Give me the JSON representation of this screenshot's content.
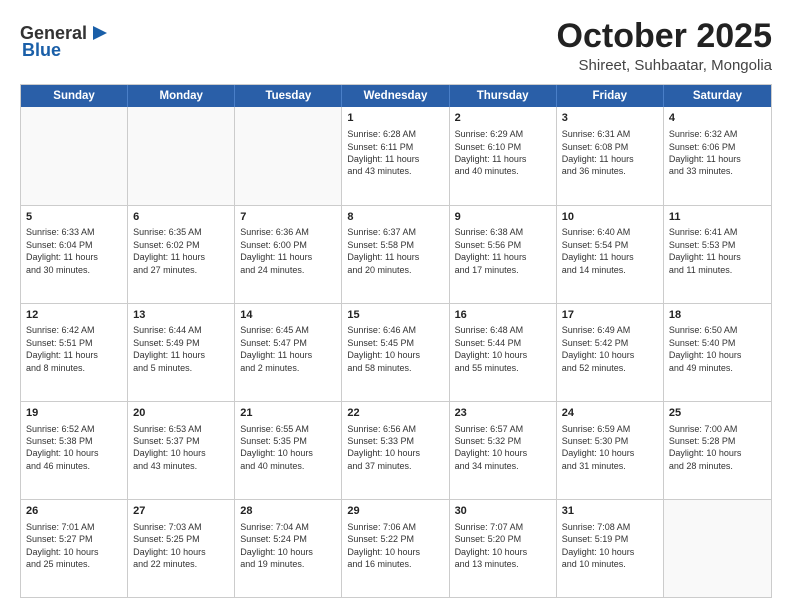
{
  "header": {
    "logo_general": "General",
    "logo_blue": "Blue",
    "month_title": "October 2025",
    "location": "Shireet, Suhbaatar, Mongolia"
  },
  "weekdays": [
    "Sunday",
    "Monday",
    "Tuesday",
    "Wednesday",
    "Thursday",
    "Friday",
    "Saturday"
  ],
  "rows": [
    [
      {
        "day": "",
        "text": ""
      },
      {
        "day": "",
        "text": ""
      },
      {
        "day": "",
        "text": ""
      },
      {
        "day": "1",
        "text": "Sunrise: 6:28 AM\nSunset: 6:11 PM\nDaylight: 11 hours\nand 43 minutes."
      },
      {
        "day": "2",
        "text": "Sunrise: 6:29 AM\nSunset: 6:10 PM\nDaylight: 11 hours\nand 40 minutes."
      },
      {
        "day": "3",
        "text": "Sunrise: 6:31 AM\nSunset: 6:08 PM\nDaylight: 11 hours\nand 36 minutes."
      },
      {
        "day": "4",
        "text": "Sunrise: 6:32 AM\nSunset: 6:06 PM\nDaylight: 11 hours\nand 33 minutes."
      }
    ],
    [
      {
        "day": "5",
        "text": "Sunrise: 6:33 AM\nSunset: 6:04 PM\nDaylight: 11 hours\nand 30 minutes."
      },
      {
        "day": "6",
        "text": "Sunrise: 6:35 AM\nSunset: 6:02 PM\nDaylight: 11 hours\nand 27 minutes."
      },
      {
        "day": "7",
        "text": "Sunrise: 6:36 AM\nSunset: 6:00 PM\nDaylight: 11 hours\nand 24 minutes."
      },
      {
        "day": "8",
        "text": "Sunrise: 6:37 AM\nSunset: 5:58 PM\nDaylight: 11 hours\nand 20 minutes."
      },
      {
        "day": "9",
        "text": "Sunrise: 6:38 AM\nSunset: 5:56 PM\nDaylight: 11 hours\nand 17 minutes."
      },
      {
        "day": "10",
        "text": "Sunrise: 6:40 AM\nSunset: 5:54 PM\nDaylight: 11 hours\nand 14 minutes."
      },
      {
        "day": "11",
        "text": "Sunrise: 6:41 AM\nSunset: 5:53 PM\nDaylight: 11 hours\nand 11 minutes."
      }
    ],
    [
      {
        "day": "12",
        "text": "Sunrise: 6:42 AM\nSunset: 5:51 PM\nDaylight: 11 hours\nand 8 minutes."
      },
      {
        "day": "13",
        "text": "Sunrise: 6:44 AM\nSunset: 5:49 PM\nDaylight: 11 hours\nand 5 minutes."
      },
      {
        "day": "14",
        "text": "Sunrise: 6:45 AM\nSunset: 5:47 PM\nDaylight: 11 hours\nand 2 minutes."
      },
      {
        "day": "15",
        "text": "Sunrise: 6:46 AM\nSunset: 5:45 PM\nDaylight: 10 hours\nand 58 minutes."
      },
      {
        "day": "16",
        "text": "Sunrise: 6:48 AM\nSunset: 5:44 PM\nDaylight: 10 hours\nand 55 minutes."
      },
      {
        "day": "17",
        "text": "Sunrise: 6:49 AM\nSunset: 5:42 PM\nDaylight: 10 hours\nand 52 minutes."
      },
      {
        "day": "18",
        "text": "Sunrise: 6:50 AM\nSunset: 5:40 PM\nDaylight: 10 hours\nand 49 minutes."
      }
    ],
    [
      {
        "day": "19",
        "text": "Sunrise: 6:52 AM\nSunset: 5:38 PM\nDaylight: 10 hours\nand 46 minutes."
      },
      {
        "day": "20",
        "text": "Sunrise: 6:53 AM\nSunset: 5:37 PM\nDaylight: 10 hours\nand 43 minutes."
      },
      {
        "day": "21",
        "text": "Sunrise: 6:55 AM\nSunset: 5:35 PM\nDaylight: 10 hours\nand 40 minutes."
      },
      {
        "day": "22",
        "text": "Sunrise: 6:56 AM\nSunset: 5:33 PM\nDaylight: 10 hours\nand 37 minutes."
      },
      {
        "day": "23",
        "text": "Sunrise: 6:57 AM\nSunset: 5:32 PM\nDaylight: 10 hours\nand 34 minutes."
      },
      {
        "day": "24",
        "text": "Sunrise: 6:59 AM\nSunset: 5:30 PM\nDaylight: 10 hours\nand 31 minutes."
      },
      {
        "day": "25",
        "text": "Sunrise: 7:00 AM\nSunset: 5:28 PM\nDaylight: 10 hours\nand 28 minutes."
      }
    ],
    [
      {
        "day": "26",
        "text": "Sunrise: 7:01 AM\nSunset: 5:27 PM\nDaylight: 10 hours\nand 25 minutes."
      },
      {
        "day": "27",
        "text": "Sunrise: 7:03 AM\nSunset: 5:25 PM\nDaylight: 10 hours\nand 22 minutes."
      },
      {
        "day": "28",
        "text": "Sunrise: 7:04 AM\nSunset: 5:24 PM\nDaylight: 10 hours\nand 19 minutes."
      },
      {
        "day": "29",
        "text": "Sunrise: 7:06 AM\nSunset: 5:22 PM\nDaylight: 10 hours\nand 16 minutes."
      },
      {
        "day": "30",
        "text": "Sunrise: 7:07 AM\nSunset: 5:20 PM\nDaylight: 10 hours\nand 13 minutes."
      },
      {
        "day": "31",
        "text": "Sunrise: 7:08 AM\nSunset: 5:19 PM\nDaylight: 10 hours\nand 10 minutes."
      },
      {
        "day": "",
        "text": ""
      }
    ]
  ]
}
